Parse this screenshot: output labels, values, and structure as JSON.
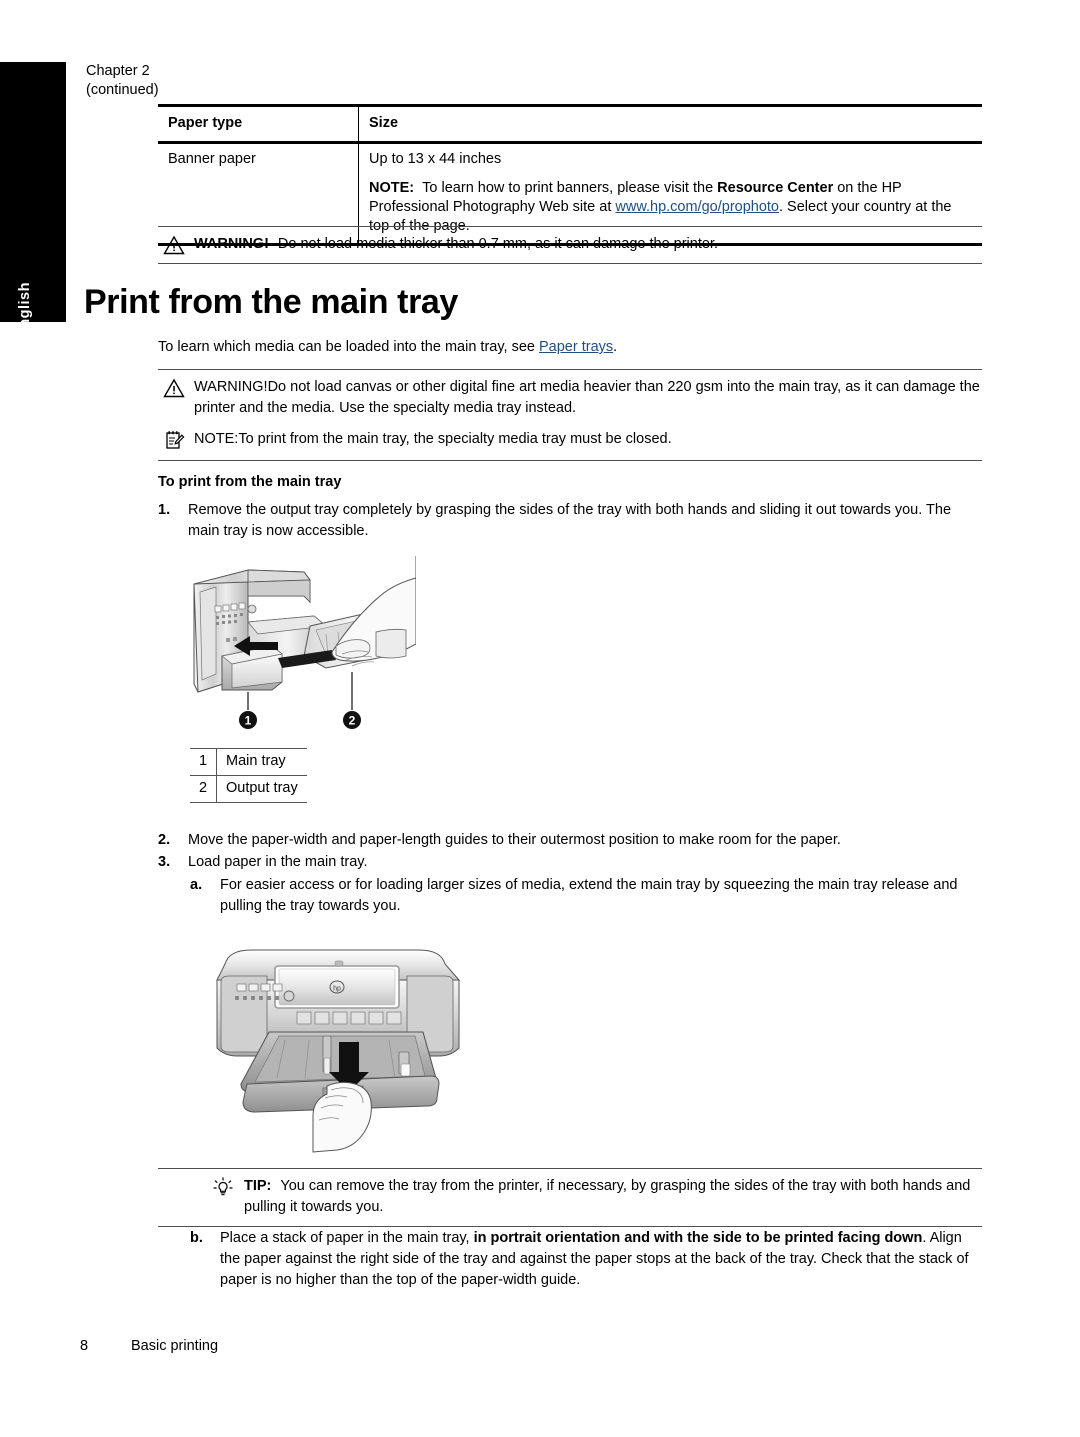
{
  "sidebar": {
    "language_tab": "English"
  },
  "header": {
    "chapter": "Chapter 2",
    "continued": "(continued)"
  },
  "spec_table": {
    "columns": [
      "Paper type",
      "Size"
    ],
    "rows": [
      {
        "paper_type": "Banner paper",
        "size": "Up to 13 x 44 inches",
        "note_label": "NOTE:",
        "note_text_1": "To learn how to print banners, please visit the ",
        "note_bold": "Resource Center",
        "note_text_2": " on the HP Professional Photography Web site at ",
        "note_link": "www.hp.com/go/prophoto",
        "note_text_3": ". Select your country at the top of the page."
      }
    ]
  },
  "warning_top": {
    "icon": "warning-triangle-icon",
    "label": "WARNING!",
    "text": "Do not load media thicker than 0.7 mm, as it can damage the printer."
  },
  "main": {
    "title": "Print from the main tray",
    "intro_text_1": "To learn which media can be loaded into the main tray, see ",
    "intro_link": "Paper trays",
    "intro_text_2": ".",
    "warning": {
      "icon": "warning-triangle-icon",
      "label": "WARNING!",
      "text": "Do not load canvas or other digital fine art media heavier than 220 gsm into the main tray, as it can damage the printer and the media. Use the specialty media tray instead."
    },
    "note": {
      "icon": "note-pad-icon",
      "label": "NOTE:",
      "text": "To print from the main tray, the specialty media tray must be closed."
    },
    "procedure_heading": "To print from the main tray",
    "steps": [
      {
        "marker": "1.",
        "text": "Remove the output tray completely by grasping the sides of the tray with both hands and sliding it out towards you. The main tray is now accessible."
      },
      {
        "marker": "2.",
        "text": "Move the paper-width and paper-length guides to their outermost position to make room for the paper."
      },
      {
        "marker": "3.",
        "text": "Load paper in the main tray."
      }
    ],
    "substeps": [
      {
        "marker": "a.",
        "text": "For easier access or for loading larger sizes of media, extend the main tray by squeezing the main tray release and pulling the tray towards you."
      },
      {
        "marker": "b.",
        "text_1": "Place a stack of paper in the main tray, ",
        "bold": "in portrait orientation and with the side to be printed facing down",
        "text_2": ". Align the paper against the right side of the tray and against the paper stops at the back of the tray. Check that the stack of paper is no higher than the top of the paper-width guide."
      }
    ],
    "tip": {
      "icon": "lightbulb-icon",
      "label": "TIP:",
      "text": "You can remove the tray from the printer, if necessary, by grasping the sides of the tray with both hands and pulling it towards you."
    }
  },
  "figure_1": {
    "name": "printer-output-tray-removal-illustration",
    "callouts": [
      "1",
      "2"
    ],
    "legend": [
      {
        "num": "1",
        "label": "Main tray"
      },
      {
        "num": "2",
        "label": "Output tray"
      }
    ]
  },
  "figure_2": {
    "name": "printer-main-tray-extend-illustration"
  },
  "footer": {
    "page_number": "8",
    "section": "Basic printing"
  },
  "colors": {
    "link": "#1f4f82",
    "rule": "#4d4d4d",
    "tab_background": "#000000"
  }
}
